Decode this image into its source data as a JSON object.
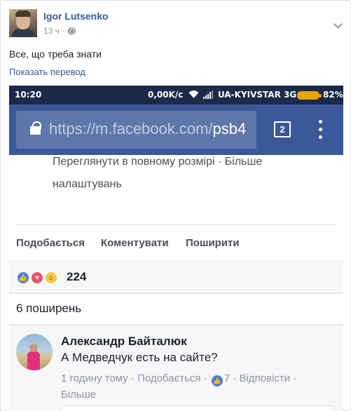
{
  "post": {
    "author": "Igor Lutsenko",
    "time": "13 ч",
    "text": "Все, що треба знати",
    "translate_link": "Показать перевод"
  },
  "screenshot": {
    "status_bar": {
      "time": "10:20",
      "speed": "0,00K/c",
      "carrier": "UA-KYIVSTAR 3G",
      "battery": "82%"
    },
    "url_bar": {
      "url_main": "https://m.facebook.com/",
      "url_rest": "psb4",
      "tab_count": "2"
    },
    "photo_links": "Переглянути в повному розмірі · Більше налаштувань",
    "actions": {
      "like": "Подобається",
      "comment": "Коментувати",
      "share": "Поширити"
    },
    "reaction_count": "224",
    "shares": "6 поширень",
    "comment": {
      "author": "Александр Байталюк",
      "text": "А Медведчук есть на сайте?",
      "meta_before": "1 годину тому · Подобається ·",
      "likes": "7",
      "meta_after": "· Відповісти ·",
      "more": "Більше"
    }
  },
  "colors": {
    "link": "#365899",
    "facebook_blue": "#3b5998",
    "status_bar": "#1c2a4a",
    "battery": "#e8a400",
    "muted": "#90949c"
  },
  "icons": [
    "globe-icon",
    "chevron-down-icon",
    "wifi-icon",
    "signal-icon",
    "battery-icon",
    "lock-icon",
    "tabs-icon",
    "overflow-menu-icon",
    "like-reaction-icon",
    "love-reaction-icon",
    "haha-reaction-icon"
  ]
}
